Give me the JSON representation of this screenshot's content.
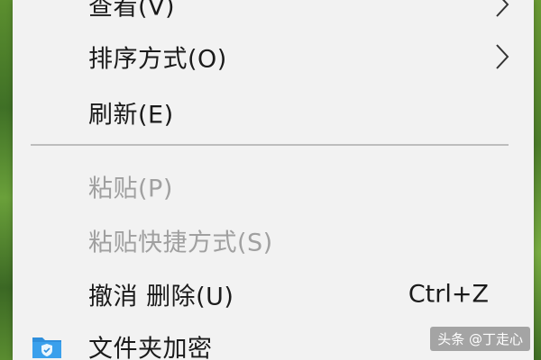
{
  "context_menu": {
    "items": [
      {
        "label": "查看(V)",
        "has_submenu": true,
        "enabled": true
      },
      {
        "label": "排序方式(O)",
        "has_submenu": true,
        "enabled": true
      },
      {
        "label": "刷新(E)",
        "has_submenu": false,
        "enabled": true
      },
      {
        "label": "粘贴(P)",
        "has_submenu": false,
        "enabled": false
      },
      {
        "label": "粘贴快捷方式(S)",
        "has_submenu": false,
        "enabled": false
      },
      {
        "label": "撤消 删除(U)",
        "shortcut": "Ctrl+Z",
        "has_submenu": false,
        "enabled": true
      },
      {
        "label": "文件夹加密",
        "icon": "folder-shield-icon",
        "has_submenu": false,
        "enabled": true
      }
    ]
  },
  "watermark": {
    "text": "头条 @丁走心"
  },
  "colors": {
    "menu_bg": "#f2f2f2",
    "text": "#1a1a1a",
    "disabled_text": "#a0a0a0",
    "separator": "#bdbdbd",
    "folder_icon": "#2f8fdc"
  }
}
